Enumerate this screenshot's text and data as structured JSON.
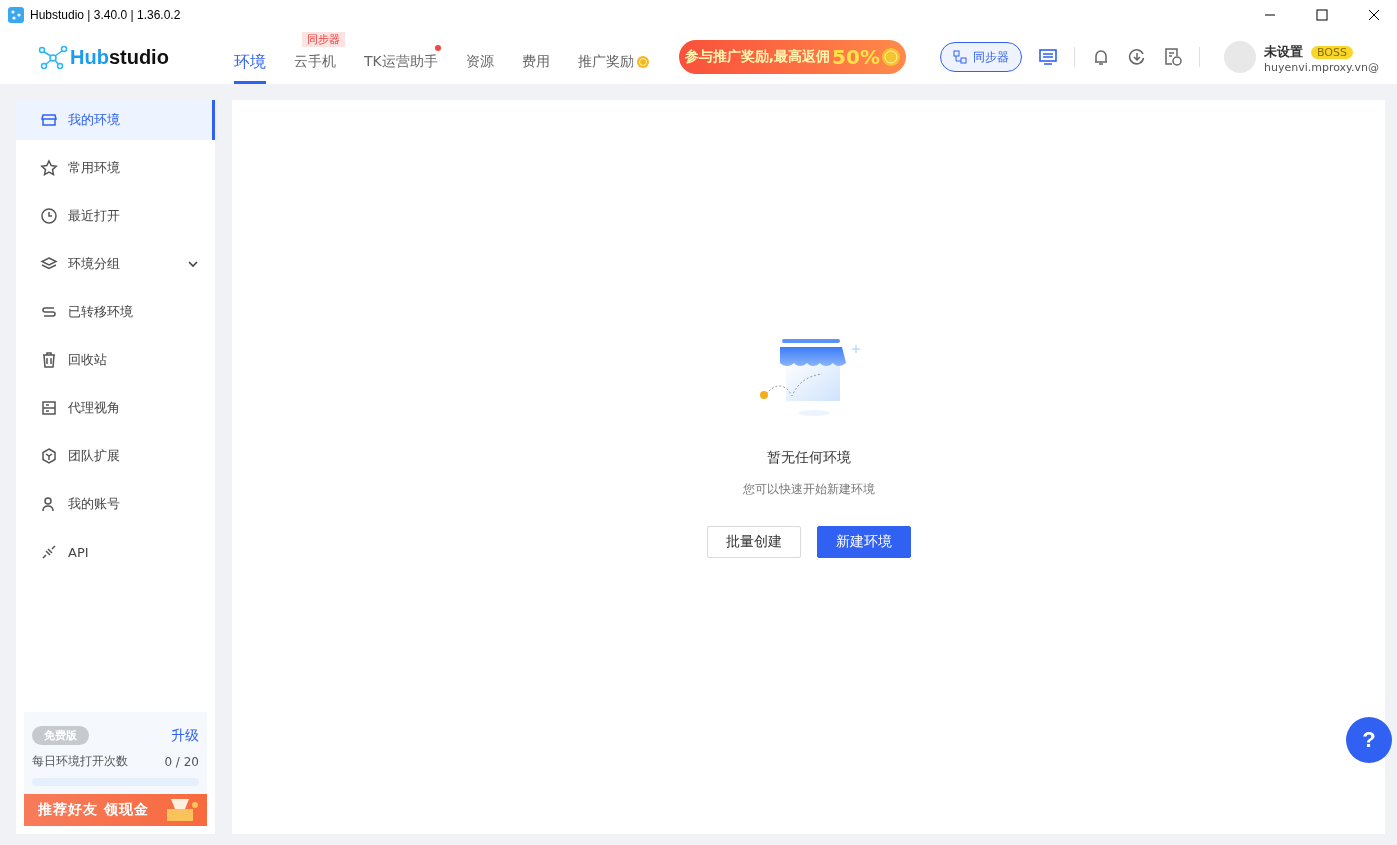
{
  "window": {
    "title": "Hubstudio | 3.40.0 | 1.36.0.2"
  },
  "logo": {
    "prefix": "Hub",
    "suffix": "studio"
  },
  "nav": [
    {
      "label": "环境",
      "selected": true
    },
    {
      "label": "云手机",
      "selected": false,
      "badge": "同步器"
    },
    {
      "label": "TK运营助手",
      "selected": false,
      "dot": true
    },
    {
      "label": "资源",
      "selected": false
    },
    {
      "label": "费用",
      "selected": false
    },
    {
      "label": "推广奖励",
      "selected": false,
      "coin": true
    }
  ],
  "promo_banner": {
    "text": "参与推广奖励,最高返佣",
    "highlight": "50%"
  },
  "sync_button": "同步器",
  "user": {
    "name": "未设置",
    "badge": "BOSS",
    "email": "huyenvi.mproxy.vn@"
  },
  "sidebar": {
    "items": [
      {
        "kind": "store",
        "label": "我的环境",
        "selected": true
      },
      {
        "kind": "star",
        "label": "常用环境",
        "selected": false
      },
      {
        "kind": "clock",
        "label": "最近打开",
        "selected": false
      },
      {
        "kind": "layers",
        "label": "环境分组",
        "selected": false,
        "expandable": true
      },
      {
        "kind": "transfer",
        "label": "已转移环境",
        "selected": false
      },
      {
        "kind": "trash",
        "label": "回收站",
        "selected": false
      },
      {
        "kind": "list",
        "label": "代理视角",
        "selected": false
      },
      {
        "kind": "cube",
        "label": "团队扩展",
        "selected": false
      },
      {
        "kind": "user",
        "label": "我的账号",
        "selected": false
      },
      {
        "kind": "plug",
        "label": "API",
        "selected": false
      }
    ],
    "plan": {
      "badge": "免费版",
      "upgrade": "升级",
      "usage_label": "每日环境打开次数",
      "usage": "0 / 20",
      "level": 0
    },
    "referral": "推荐好友 领现金"
  },
  "empty_state": {
    "title": "暂无任何环境",
    "subtitle": "您可以快速开始新建环境",
    "buttons": [
      {
        "kind": "secondary",
        "label": "批量创建"
      },
      {
        "kind": "primary",
        "label": "新建环境"
      }
    ]
  },
  "help_button": "?"
}
